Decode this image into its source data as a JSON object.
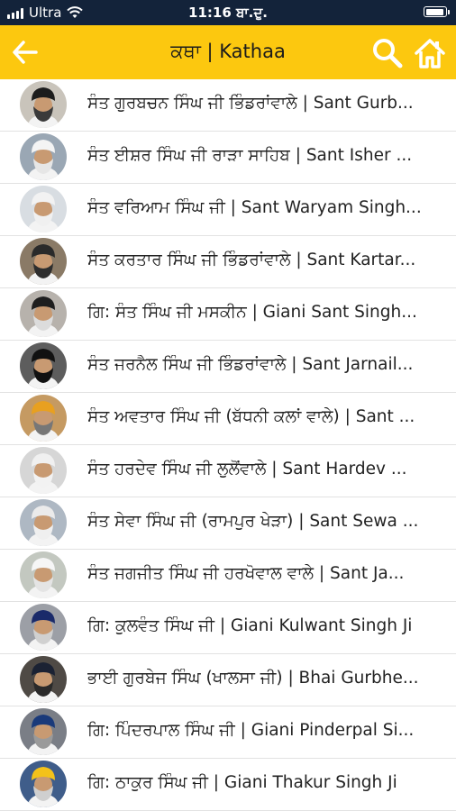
{
  "status_bar": {
    "carrier": "Ultra",
    "time": "11:16 ਬਾ.ਦੁ.",
    "icons": [
      "signal-icon",
      "wifi-icon",
      "battery-icon"
    ]
  },
  "header": {
    "title": "ਕਥਾ | Kathaa",
    "back_icon": "back-arrow-icon",
    "search_icon": "search-icon",
    "home_icon": "home-icon",
    "background_color": "#fcc80f"
  },
  "list": [
    {
      "label": "ਸੰਤ ਗੁਰਬਚਨ ਸਿੰਘ ਜੀ ਭਿੰਡਰਾਂਵਾਲੇ | Sant Gurb..."
    },
    {
      "label": "ਸੰਤ ਈਸ਼ਰ ਸਿੰਘ ਜੀ ਰਾੜਾ ਸਾਹਿਬ | Sant Isher ..."
    },
    {
      "label": "ਸੰਤ ਵਰਿਆਮ ਸਿੰਘ ਜੀ | Sant Waryam Singh..."
    },
    {
      "label": "ਸੰਤ ਕਰਤਾਰ ਸਿੰਘ ਜੀ ਭਿੰਡਰਾਂਵਾਲੇ | Sant Kartar..."
    },
    {
      "label": "ਗਿ: ਸੰਤ ਸਿੰਘ ਜੀ ਮਸਕੀਨ | Giani Sant Singh..."
    },
    {
      "label": "ਸੰਤ ਜਰਨੈਲ ਸਿੰਘ ਜੀ ਭਿੰਡਰਾਂਵਾਲੇ | Sant Jarnail..."
    },
    {
      "label": "ਸੰਤ ਅਵਤਾਰ ਸਿੰਘ ਜੀ (ਬੱਧਨੀ ਕਲਾਂ ਵਾਲੇ) | Sant ..."
    },
    {
      "label": "ਸੰਤ ਹਰਦੇਵ ਸਿੰਘ ਜੀ ਲੁਲੋਂਵਾਲੇ | Sant Hardev ..."
    },
    {
      "label": "ਸੰਤ ਸੇਵਾ ਸਿੰਘ ਜੀ (ਰਾਮਪੁਰ ਖੇੜਾ) | Sant Sewa ..."
    },
    {
      "label": "ਸੰਤ ਜਗਜੀਤ ਸਿੰਘ ਜੀ ਹਰਖੋਵਾਲ ਵਾਲੇ | Sant Ja..."
    },
    {
      "label": "ਗਿ: ਕੁਲਵੰਤ ਸਿੰਘ ਜੀ | Giani Kulwant Singh Ji"
    },
    {
      "label": "ਭਾਈ ਗੁਰਬੇਜ ਸਿੰਘ (ਖਾਲਸਾ ਜੀ) | Bhai Gurbhe..."
    },
    {
      "label": "ਗਿ: ਪਿੰਦਰਪਾਲ ਸਿੰਘ ਜੀ | Giani Pinderpal Si..."
    },
    {
      "label": "ਗਿ: ਠਾਕੁਰ ਸਿੰਘ ਜੀ | Giani Thakur Singh Ji"
    }
  ],
  "avatar_colors": {
    "turbans": [
      "#1c1c1c",
      "#f4f4f4",
      "#f2f2f2",
      "#2a2a2a",
      "#1e1e1e",
      "#111111",
      "#e8a020",
      "#f0f0f0",
      "#ebebeb",
      "#f6f6f6",
      "#1a2a6a",
      "#1b2233",
      "#1a3a7a",
      "#f3c21a"
    ],
    "backgrounds": [
      "#c9c4bb",
      "#9aa7b4",
      "#d8dde2",
      "#8a7a66",
      "#b7b2ac",
      "#5d5d5d",
      "#c59a62",
      "#d6d6d6",
      "#aeb8c3",
      "#c3c8c0",
      "#9c9fa6",
      "#4f4a45",
      "#7a7e86",
      "#3f5d8a"
    ],
    "beards": [
      "#3a3a3a",
      "#e6e6e6",
      "#f0f0f0",
      "#2e2e2e",
      "#dcdcdc",
      "#111111",
      "#777777",
      "#f2f2f2",
      "#efefef",
      "#e4e4e4",
      "#d0d0d0",
      "#2a2a2a",
      "#9a9a9a",
      "#cfcfcf"
    ]
  }
}
